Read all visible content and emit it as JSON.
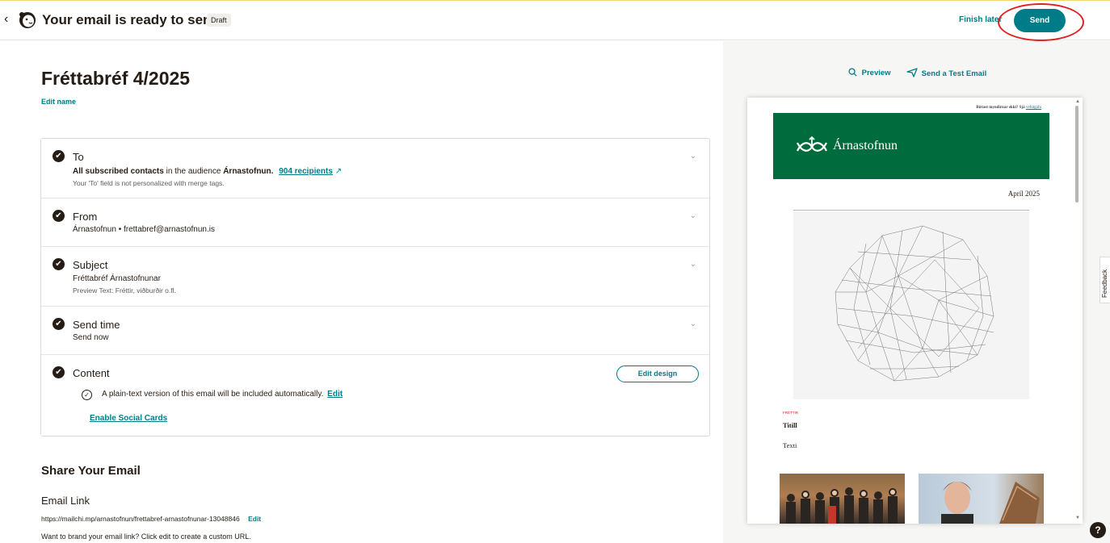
{
  "topbar": {
    "back_glyph": "‹",
    "title": "Your email is ready to send!",
    "badge": "Draft",
    "finish_later": "Finish later",
    "send": "Send"
  },
  "campaign": {
    "name": "Fréttabréf 4/2025",
    "edit_name": "Edit name"
  },
  "checklist": {
    "to": {
      "title": "To",
      "line_bold": "All subscribed contacts",
      "line_mid": " in the audience ",
      "line_audience": "Árnastofnun.",
      "recipients": "904 recipients",
      "sub": "Your 'To' field is not personalized with merge tags."
    },
    "from": {
      "title": "From",
      "line": "Árnastofnun  •  frettabref@arnastofnun.is"
    },
    "subject": {
      "title": "Subject",
      "line": "Fréttabréf Árnastofnunar",
      "sub": "Preview Text: Fréttir, viðburðir o.fl."
    },
    "send_time": {
      "title": "Send time",
      "line": "Send now"
    },
    "content": {
      "title": "Content",
      "edit_design": "Edit design",
      "plain_text": "A plain-text version of this email will be included automatically.",
      "plain_edit": "Edit",
      "social_cards": "Enable Social Cards"
    }
  },
  "share": {
    "heading": "Share Your Email",
    "email_link_heading": "Email Link",
    "url": "https://mailchi.mp/arnastofnun/frettabref-arnastofnunar-13048846",
    "url_edit": "Edit",
    "brand_note": "Want to brand your email link? Click edit to create a custom URL."
  },
  "preview_panel": {
    "preview": "Preview",
    "send_test": "Send a Test Email",
    "email": {
      "top_note": "Birtast myndirnar ekki? Sjá ",
      "top_note_link": "vefútgáfu",
      "org_name": "Árnastofnun",
      "date": "Apríl 2025",
      "category": "FRÉTTIR",
      "headline": "Titill",
      "body": "Texti"
    }
  },
  "side": {
    "feedback": "Feedback",
    "help": "?"
  },
  "colors": {
    "accent": "#007c89",
    "email_header": "#006b3c",
    "annotation": "#e02020"
  },
  "icons": [
    "chevron-left-icon",
    "mailchimp-logo-icon",
    "check-circle-icon",
    "chevron-down-icon",
    "external-link-icon",
    "search-icon",
    "send-icon",
    "help-icon"
  ]
}
